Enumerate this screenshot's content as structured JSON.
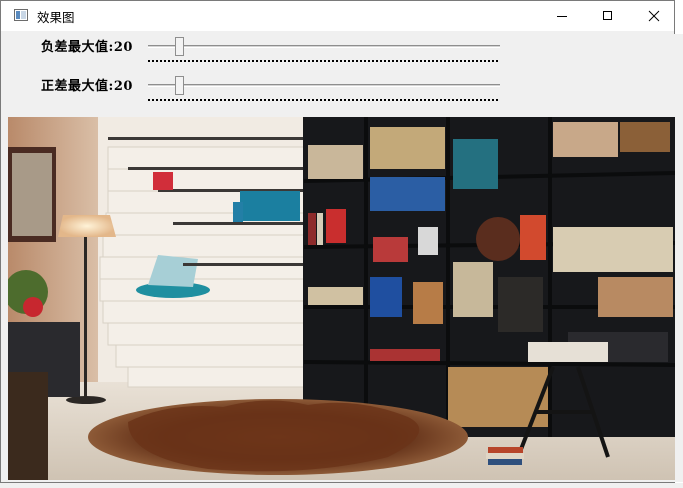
{
  "window": {
    "title": "效果图"
  },
  "sliders": [
    {
      "label": "负差最大值:",
      "value": "20",
      "min": 0,
      "max": 255
    },
    {
      "label": "正差最大值:",
      "value": "20",
      "min": 0,
      "max": 255
    }
  ],
  "image": {
    "description_icon": "photo-image"
  },
  "colors": {
    "window_bg": "#f0f0f0",
    "titlebar_bg": "#ffffff"
  }
}
